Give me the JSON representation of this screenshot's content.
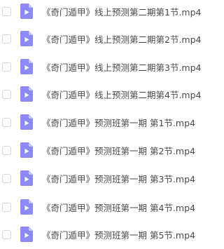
{
  "colors": {
    "icon_fill": "#8c8bf5",
    "icon_fold": "#c4c3fb",
    "text": "#4a4a4a",
    "checkbox_border": "#d9d9d9"
  },
  "files": [
    {
      "name": "《奇门遁甲》线上预测第二期第1节.mp4",
      "icon": "video-file-icon",
      "checked": false
    },
    {
      "name": "《奇门遁甲》线上预测第二期第2节.mp4",
      "icon": "video-file-icon",
      "checked": false
    },
    {
      "name": "《奇门遁甲》线上预测第二期第3节.mp4",
      "icon": "video-file-icon",
      "checked": false
    },
    {
      "name": "《奇门遁甲》线上预测第二期第4节.mp4",
      "icon": "video-file-icon",
      "checked": false
    },
    {
      "name": "《奇门遁甲》预测班第一期 第1节.mp4",
      "icon": "video-file-icon",
      "checked": false
    },
    {
      "name": "《奇门遁甲》预测班第一期 第2节.mp4",
      "icon": "video-file-icon",
      "checked": false
    },
    {
      "name": "《奇门遁甲》预测班第一期 第3节.mp4",
      "icon": "video-file-icon",
      "checked": false
    },
    {
      "name": "《奇门遁甲》预测班第一期 第4节.mp4",
      "icon": "video-file-icon",
      "checked": false
    },
    {
      "name": "《奇门遁甲》预测班第一期 第5节.mp4",
      "icon": "video-file-icon",
      "checked": false
    }
  ]
}
